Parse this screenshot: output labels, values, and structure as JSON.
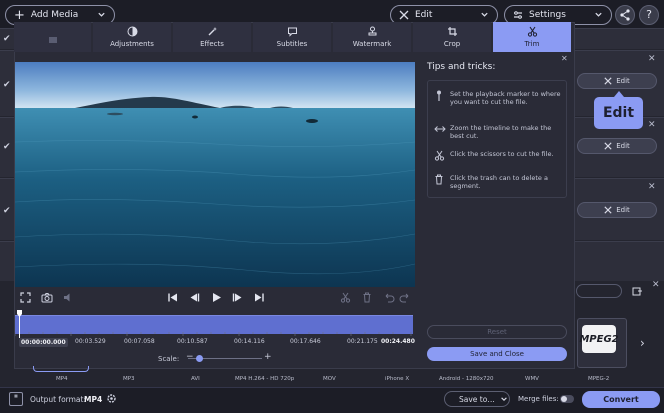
{
  "topbar": {
    "add_media_label": "Add Media",
    "edit_label": "Edit",
    "settings_label": "Settings"
  },
  "tabs": [
    {
      "label": "Adjustments",
      "icon": "adjustments-icon"
    },
    {
      "label": "Effects",
      "icon": "magic-wand-icon"
    },
    {
      "label": "Subtitles",
      "icon": "speech-bubble-icon"
    },
    {
      "label": "Watermark",
      "icon": "stamp-icon"
    },
    {
      "label": "Crop",
      "icon": "crop-icon"
    },
    {
      "label": "Trim",
      "icon": "scissors-icon",
      "active": true
    }
  ],
  "tips": {
    "title": "Tips and tricks:",
    "items": [
      {
        "icon": "marker-icon",
        "text": "Set the playback marker to where you want to cut the file."
      },
      {
        "icon": "zoom-arrows-icon",
        "text": "Zoom the timeline to make the best cut."
      },
      {
        "icon": "scissors-icon",
        "text": "Click the scissors to cut the file."
      },
      {
        "icon": "trash-icon",
        "text": "Click the trash can to delete a segment."
      }
    ]
  },
  "timeline": {
    "labels": [
      "00:00:00.000",
      "00:03.529",
      "00:07.058",
      "00:10.587",
      "00:14.116",
      "00:17.646",
      "00:21.175",
      "00:24.480"
    ]
  },
  "scale": {
    "label": "Scale:",
    "minus": "−",
    "plus": "+"
  },
  "buttons": {
    "reset": "Reset",
    "save_close": "Save and Close",
    "row_edit": "Edit",
    "edit_tooltip": "Edit",
    "convert": "Convert",
    "save_to": "Save to…"
  },
  "formats": [
    "MP4",
    "MP3",
    "AVI",
    "MP4 H.264 - HD 720p",
    "MOV",
    "iPhone X",
    "Android - 1280x720",
    "WMV",
    "MPEG-2"
  ],
  "format_card": {
    "logo": "MPEG2"
  },
  "bottombar": {
    "output_label": "Output format:",
    "output_value": "MP4",
    "merge_label": "Merge files:"
  },
  "colors": {
    "accent": "#8b9bf3",
    "timeline": "#5f6fd0",
    "background": "#24252f"
  }
}
